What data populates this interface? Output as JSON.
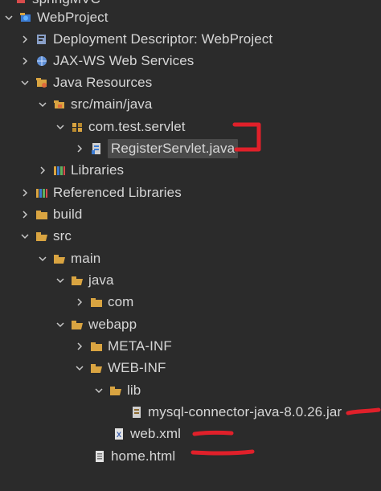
{
  "colors": {
    "background": "#2b2b2b",
    "text": "#d6d6d6",
    "folder": "#d9a441",
    "red_mark": "#e0202a",
    "selection": "#4a4a4a"
  },
  "tree": {
    "top_partial_label": "springMVC",
    "items": [
      {
        "label": "WebProject",
        "icon": "web-project-icon",
        "expanded": true
      },
      {
        "label": "Deployment Descriptor: WebProject",
        "icon": "deployment-descriptor-icon",
        "expanded": false
      },
      {
        "label": "JAX-WS Web Services",
        "icon": "web-services-icon",
        "expanded": false
      },
      {
        "label": "Java Resources",
        "icon": "java-resources-icon",
        "expanded": true
      },
      {
        "label": "src/main/java",
        "icon": "source-folder-icon",
        "expanded": true
      },
      {
        "label": "com.test.servlet",
        "icon": "package-icon",
        "expanded": true
      },
      {
        "label": "RegisterServlet.java",
        "icon": "java-file-icon",
        "expanded": false,
        "selected": true
      },
      {
        "label": "Libraries",
        "icon": "libraries-icon",
        "expanded": false
      },
      {
        "label": "Referenced Libraries",
        "icon": "libraries-icon",
        "expanded": false
      },
      {
        "label": "build",
        "icon": "folder-icon",
        "expanded": false
      },
      {
        "label": "src",
        "icon": "folder-icon",
        "expanded": true
      },
      {
        "label": "main",
        "icon": "folder-icon",
        "expanded": true
      },
      {
        "label": "java",
        "icon": "folder-icon",
        "expanded": true
      },
      {
        "label": "com",
        "icon": "folder-icon",
        "expanded": false
      },
      {
        "label": "webapp",
        "icon": "folder-icon",
        "expanded": true
      },
      {
        "label": "META-INF",
        "icon": "folder-icon",
        "expanded": false
      },
      {
        "label": "WEB-INF",
        "icon": "folder-icon",
        "expanded": true
      },
      {
        "label": "lib",
        "icon": "folder-icon",
        "expanded": true
      },
      {
        "label": "mysql-connector-java-8.0.26.jar",
        "icon": "jar-file-icon"
      },
      {
        "label": "web.xml",
        "icon": "xml-file-icon"
      },
      {
        "label": "home.html",
        "icon": "html-file-icon"
      }
    ]
  }
}
